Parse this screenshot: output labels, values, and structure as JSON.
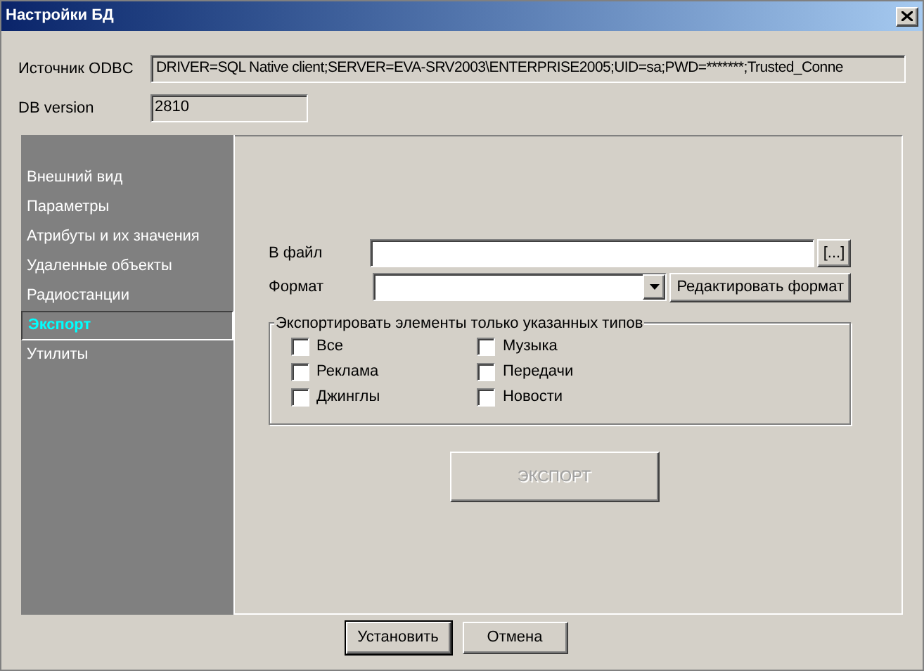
{
  "window": {
    "title": "Настройки БД"
  },
  "odbc": {
    "label": "Источник ODBC",
    "value": "DRIVER=SQL Native client;SERVER=EVA-SRV2003\\ENTERPRISE2005;UID=sa;PWD=*******;Trusted_Conne"
  },
  "db_version": {
    "label": "DB version",
    "value": "2810"
  },
  "sidebar": {
    "items": [
      {
        "label": "Внешний вид",
        "selected": false
      },
      {
        "label": "Параметры",
        "selected": false
      },
      {
        "label": "Атрибуты и их значения",
        "selected": false
      },
      {
        "label": "Удаленные объекты",
        "selected": false
      },
      {
        "label": "Радиостанции",
        "selected": false
      },
      {
        "label": "Экспорт",
        "selected": true
      },
      {
        "label": "Утилиты",
        "selected": false
      }
    ]
  },
  "export": {
    "file_label": "В файл",
    "browse_button": "[...]",
    "format_label": "Формат",
    "edit_format_button": "Редактировать формат",
    "group_title": "Экспортировать элементы только указанных типов",
    "checkboxes": [
      {
        "label": "Все",
        "checked": false
      },
      {
        "label": "Реклама",
        "checked": false
      },
      {
        "label": "Джинглы",
        "checked": false
      },
      {
        "label": "Музыка",
        "checked": false
      },
      {
        "label": "Передачи",
        "checked": false
      },
      {
        "label": "Новости",
        "checked": false
      }
    ],
    "export_button": {
      "label": "ЭКСПОРТ",
      "disabled": true
    }
  },
  "buttons": [
    {
      "label": "Установить",
      "default": true
    },
    {
      "label": "Отмена",
      "default": false
    }
  ]
}
